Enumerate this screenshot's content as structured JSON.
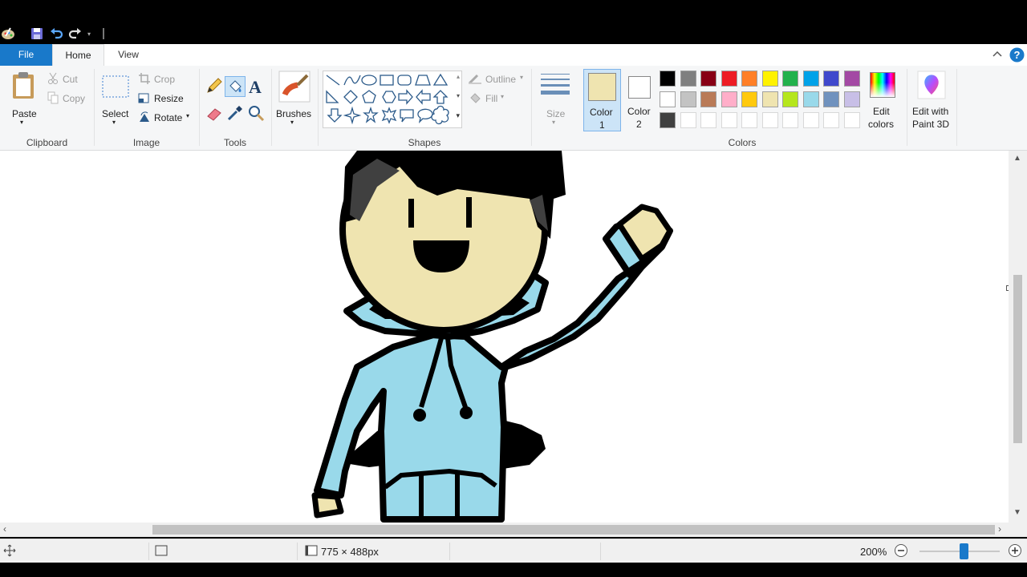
{
  "quick_access": {
    "icons": [
      "paint-app-icon",
      "save-icon",
      "undo-icon",
      "redo-icon",
      "customize-qat-icon"
    ]
  },
  "tabs": {
    "file": "File",
    "home": "Home",
    "view": "View"
  },
  "clipboard": {
    "paste": "Paste",
    "cut": "Cut",
    "copy": "Copy",
    "group": "Clipboard"
  },
  "image": {
    "select": "Select",
    "crop": "Crop",
    "resize": "Resize",
    "rotate": "Rotate",
    "group": "Image"
  },
  "tools": {
    "text_glyph": "A",
    "group": "Tools"
  },
  "brushes": {
    "label": "Brushes"
  },
  "shapes": {
    "outline": "Outline",
    "fill": "Fill",
    "group": "Shapes"
  },
  "size": {
    "label": "Size"
  },
  "colors": {
    "color1_label": "Color",
    "color1_num": "1",
    "color2_label": "Color",
    "color2_num": "2",
    "edit_colors_line1": "Edit",
    "edit_colors_line2": "colors",
    "paint3d_line1": "Edit with",
    "paint3d_line2": "Paint 3D",
    "group": "Colors",
    "color1_value": "#efe4b0",
    "color2_value": "#ffffff",
    "palette_row1": [
      "#000000",
      "#7f7f7f",
      "#880015",
      "#ed1c24",
      "#ff7f27",
      "#fff200",
      "#22b14c",
      "#00a2e8",
      "#3f48cc",
      "#a349a4"
    ],
    "palette_row2": [
      "#ffffff",
      "#c3c3c3",
      "#b97a57",
      "#ffaec9",
      "#ffc90e",
      "#efe4b0",
      "#b5e61d",
      "#99d9ea",
      "#7092be",
      "#c8bfe7"
    ],
    "palette_row3": [
      "#404040",
      "",
      "",
      "",
      "",
      "",
      "",
      "",
      "",
      ""
    ]
  },
  "status": {
    "dimensions": "775 × 488px",
    "zoom": "200%",
    "zoom_level": 0.55
  }
}
